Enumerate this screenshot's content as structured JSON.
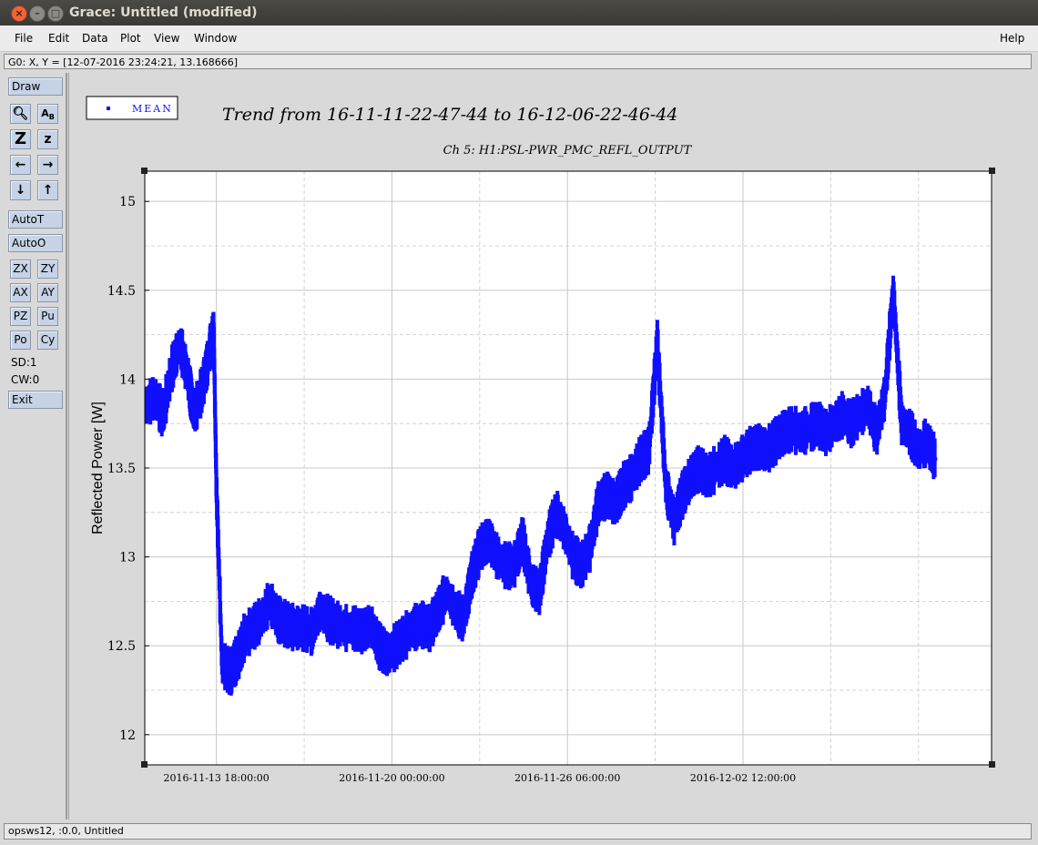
{
  "window": {
    "title": "Grace: Untitled (modified)"
  },
  "menu": {
    "file": "File",
    "edit": "Edit",
    "data": "Data",
    "plot": "Plot",
    "view": "View",
    "window": "Window",
    "help": "Help"
  },
  "locator": "G0: X, Y = [12-07-2016 23:24:21, 13.168666]",
  "toolbar": {
    "draw": "Draw",
    "autot": "AutoT",
    "autoo": "AutoO",
    "zx": "ZX",
    "zy": "ZY",
    "ax": "AX",
    "ay": "AY",
    "pz": "PZ",
    "pu": "Pu",
    "po": "Po",
    "cy": "Cy",
    "sd": "SD:1",
    "cw": "CW:0",
    "exit": "Exit"
  },
  "status": "opsws12, :0.0, Untitled",
  "colors": {
    "series": "#1010ff",
    "grid": "#c8c8c8"
  },
  "chart_data": {
    "type": "scatter",
    "title": "Trend from 16-11-11-22-47-44 to 16-12-06-22-46-44",
    "subtitle": "Ch 5: H1:PSL-PWR_PMC_REFL_OUTPUT",
    "xlabel": "",
    "ylabel": "Reflected Power [W]",
    "ylim": [
      11.83,
      15.17
    ],
    "xlim_days_from_tick1": [
      -2.55,
      27.6
    ],
    "x_ticks": [
      "2016-11-13 18:00:00",
      "2016-11-20 00:00:00",
      "2016-11-26 06:00:00",
      "2016-12-02 12:00:00"
    ],
    "y_ticks": [
      "12",
      "12.5",
      "13",
      "13.5",
      "14",
      "14.5",
      "15"
    ],
    "legend": {
      "label": "MEAN",
      "placement": "top-left"
    },
    "grid": true,
    "series": [
      {
        "name": "MEAN",
        "x_tick_positions": [
          0,
          6.25,
          12.5,
          18.75
        ],
        "points": [
          [
            -2.5,
            13.85
          ],
          [
            -2.2,
            13.9
          ],
          [
            -1.9,
            13.8
          ],
          [
            -1.6,
            14.05
          ],
          [
            -1.3,
            14.2
          ],
          [
            -1.0,
            14.0
          ],
          [
            -0.8,
            13.8
          ],
          [
            -0.5,
            13.95
          ],
          [
            -0.3,
            14.1
          ],
          [
            -0.1,
            14.3
          ],
          [
            0.0,
            13.4
          ],
          [
            0.2,
            12.4
          ],
          [
            0.5,
            12.35
          ],
          [
            0.8,
            12.45
          ],
          [
            1.0,
            12.55
          ],
          [
            1.3,
            12.6
          ],
          [
            1.6,
            12.65
          ],
          [
            1.9,
            12.75
          ],
          [
            2.2,
            12.65
          ],
          [
            2.5,
            12.62
          ],
          [
            2.8,
            12.6
          ],
          [
            3.1,
            12.6
          ],
          [
            3.4,
            12.58
          ],
          [
            3.7,
            12.7
          ],
          [
            4.0,
            12.65
          ],
          [
            4.3,
            12.62
          ],
          [
            4.6,
            12.6
          ],
          [
            4.9,
            12.6
          ],
          [
            5.2,
            12.58
          ],
          [
            5.5,
            12.62
          ],
          [
            5.8,
            12.5
          ],
          [
            6.1,
            12.45
          ],
          [
            6.4,
            12.5
          ],
          [
            6.7,
            12.55
          ],
          [
            7.0,
            12.6
          ],
          [
            7.3,
            12.62
          ],
          [
            7.6,
            12.6
          ],
          [
            7.9,
            12.7
          ],
          [
            8.2,
            12.8
          ],
          [
            8.5,
            12.7
          ],
          [
            8.8,
            12.65
          ],
          [
            9.1,
            12.9
          ],
          [
            9.4,
            13.05
          ],
          [
            9.7,
            13.1
          ],
          [
            10.0,
            13.0
          ],
          [
            10.3,
            12.95
          ],
          [
            10.6,
            12.95
          ],
          [
            10.9,
            13.1
          ],
          [
            11.2,
            12.85
          ],
          [
            11.5,
            12.8
          ],
          [
            11.8,
            13.1
          ],
          [
            12.1,
            13.25
          ],
          [
            12.4,
            13.15
          ],
          [
            12.7,
            13.0
          ],
          [
            13.0,
            12.95
          ],
          [
            13.3,
            13.05
          ],
          [
            13.6,
            13.3
          ],
          [
            13.9,
            13.35
          ],
          [
            14.2,
            13.3
          ],
          [
            14.5,
            13.4
          ],
          [
            14.8,
            13.45
          ],
          [
            15.1,
            13.55
          ],
          [
            15.4,
            13.6
          ],
          [
            15.7,
            14.2
          ],
          [
            16.0,
            13.4
          ],
          [
            16.3,
            13.2
          ],
          [
            16.6,
            13.35
          ],
          [
            16.9,
            13.45
          ],
          [
            17.2,
            13.5
          ],
          [
            17.5,
            13.45
          ],
          [
            17.8,
            13.5
          ],
          [
            18.1,
            13.55
          ],
          [
            18.4,
            13.5
          ],
          [
            18.7,
            13.55
          ],
          [
            19.0,
            13.6
          ],
          [
            19.3,
            13.62
          ],
          [
            19.6,
            13.6
          ],
          [
            19.9,
            13.65
          ],
          [
            20.2,
            13.7
          ],
          [
            20.5,
            13.72
          ],
          [
            20.8,
            13.7
          ],
          [
            21.1,
            13.72
          ],
          [
            21.4,
            13.75
          ],
          [
            21.7,
            13.7
          ],
          [
            22.0,
            13.75
          ],
          [
            22.3,
            13.8
          ],
          [
            22.6,
            13.75
          ],
          [
            22.9,
            13.8
          ],
          [
            23.2,
            13.85
          ],
          [
            23.5,
            13.7
          ],
          [
            23.8,
            13.9
          ],
          [
            24.1,
            14.5
          ],
          [
            24.4,
            13.75
          ],
          [
            24.7,
            13.7
          ],
          [
            25.0,
            13.6
          ],
          [
            25.3,
            13.65
          ],
          [
            25.6,
            13.55
          ]
        ]
      }
    ]
  }
}
